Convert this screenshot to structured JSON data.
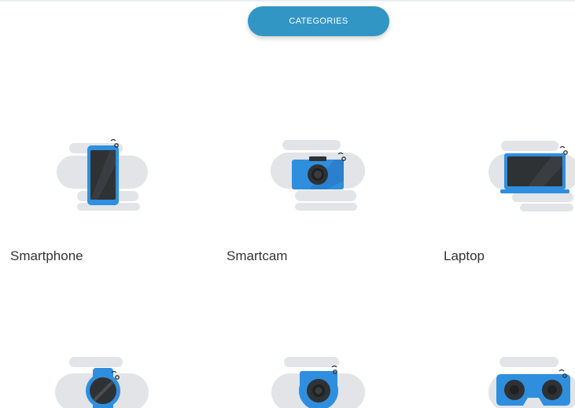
{
  "header": {
    "button_label": "CATEGORIES"
  },
  "colors": {
    "accent": "#3296c4",
    "device_blue": "#2f8fde",
    "screen": "#2f3235",
    "bg_blob": "#e2e4e8"
  },
  "categories": [
    {
      "label": "Smartphone",
      "icon": "smartphone-icon"
    },
    {
      "label": "Smartcam",
      "icon": "smartcam-icon"
    },
    {
      "label": "Laptop",
      "icon": "laptop-icon"
    },
    {
      "label": "",
      "icon": "smartwatch-icon"
    },
    {
      "label": "",
      "icon": "camera-lens-icon"
    },
    {
      "label": "",
      "icon": "vr-headset-icon"
    }
  ]
}
